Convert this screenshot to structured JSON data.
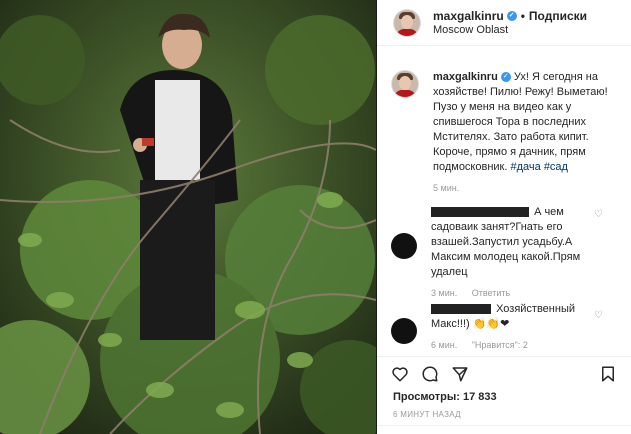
{
  "header": {
    "username": "maxgalkinru",
    "separator": "•",
    "follow_label": "Подписки",
    "location": "Moscow Oblast"
  },
  "caption": {
    "username": "maxgalkinru",
    "text": "Ух! Я сегодня на хозяйстве! Пилю! Режу! Выметаю! Пузо у меня на видео как у спившегося Тора в последних Мстителях. Зато работа кипит. Короче, прямо я дачник, прям подмосковник.",
    "hashtags": [
      "#дача",
      "#сад"
    ],
    "time": "5 мин."
  },
  "comments": [
    {
      "username_suffix": "",
      "text": "А чем садоваик занят?Гнать его взашей.Запустил усадьбу.А Максим молодец какой.Прям удалец",
      "time": "3 мин.",
      "reply_label": "Ответить"
    },
    {
      "username_suffix": "",
      "text": "Хозяйственный Макс!!!) 👏👏❤",
      "time": "6 мин.",
      "likes_label": "\"Нравится\": 2"
    }
  ],
  "stats": {
    "views_label": "Просмотры: 17 833",
    "posted": "6 МИНУТ НАЗАД"
  },
  "icons": {
    "heart": "heart-icon",
    "comment": "comment-icon",
    "share": "share-icon",
    "bookmark": "bookmark-icon",
    "verified": "verified-icon"
  },
  "colors": {
    "link": "#003569",
    "verified": "#3897f0",
    "muted": "#999999"
  }
}
